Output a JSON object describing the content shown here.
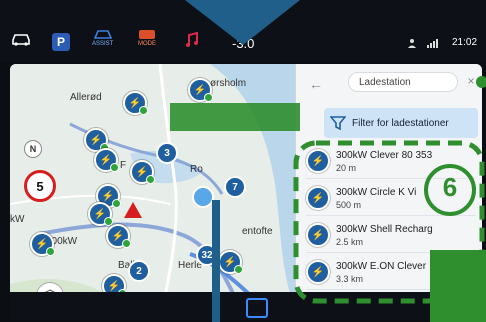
{
  "topbar": {
    "parking_label": "P",
    "assist_label": "ASSIST",
    "mode_label": "MODE",
    "temperature": "-3.0",
    "time": "21:02"
  },
  "map": {
    "places": [
      "Allerød",
      "ørsholm",
      "F",
      "300kW",
      "Ball",
      "Herle",
      "entofte",
      "Ro",
      "kW"
    ],
    "cluster_numbers": [
      "3",
      "7",
      "2",
      "32"
    ],
    "speed_limit": "5",
    "compass": "N"
  },
  "search": {
    "query": "Ladestation",
    "filter_label": "Filter for ladestationer"
  },
  "results": [
    {
      "title": "300kW Clever 80 353",
      "subtitle": "20 m"
    },
    {
      "title": "300kW Circle K Vi",
      "subtitle": "500 m"
    },
    {
      "title": "300kW Shell Recharg",
      "subtitle": "2.5 km"
    },
    {
      "title": "300kW E.ON Clever",
      "subtitle": "3.3 km"
    }
  ],
  "annotation": {
    "step_number": "6"
  },
  "colors": {
    "accent_blue": "#1f5fa0",
    "annotation_green": "#2f8f2f",
    "overlay_blue": "#1f5f8a",
    "speed_red": "#d61e1e"
  }
}
